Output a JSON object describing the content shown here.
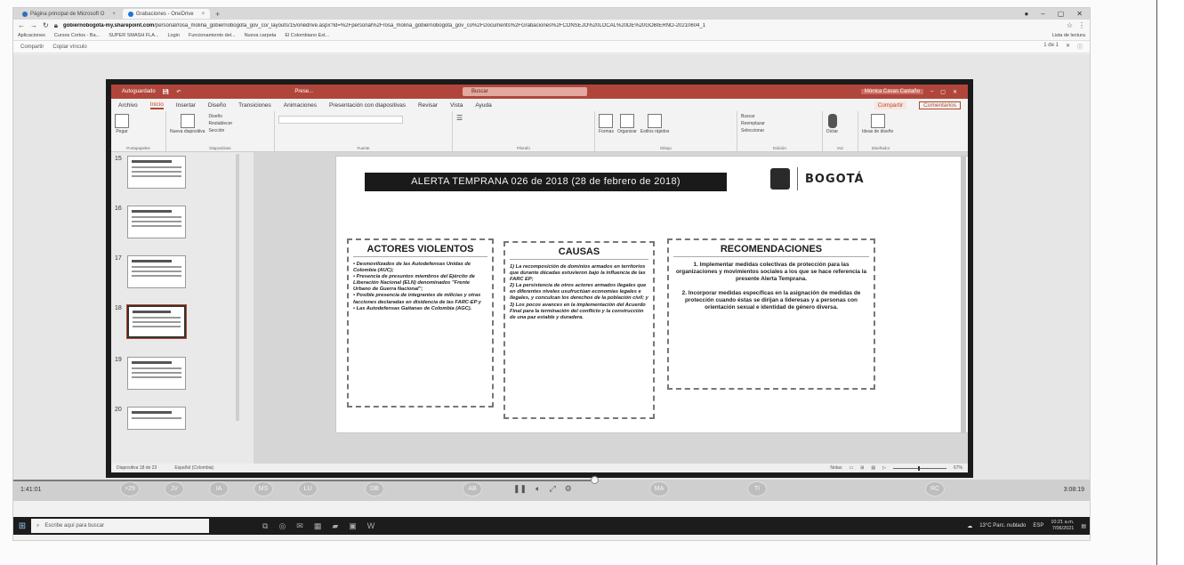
{
  "browser": {
    "tabs": [
      {
        "label": "Página principal de Microsoft O"
      },
      {
        "label": "Grabaciones - OneDrive"
      }
    ],
    "new_tab": "+",
    "url_host": "gobiernobogota-my.sharepoint.com",
    "url_path": "/personal/rosa_molina_gobiernobogota_gov_co/_layouts/15/onedrive.aspx?id=%2Fpersonal%2Frosa_molina_gobiernobogota_gov_co%2FDocuments%2FGrabaciones%2FCONSEJO%20LOCAL%20DE%20GOBIERNO-20210604_1",
    "bookmarks": [
      "Aplicaciones",
      "Cursos Cortos - Ba...",
      "SUPER SMASH FLA...",
      "Login",
      "Funcionamiento del...",
      "Nueva carpeta",
      "El Colombiano Est..."
    ],
    "reading_list": "Lista de lectura"
  },
  "onedrive": {
    "share": "Compartir",
    "copy_link": "Copiar vínculo",
    "pager": "1 de 1"
  },
  "ppt": {
    "autosave": "Autoguardado",
    "filename": "Prese...",
    "search": "Buscar",
    "user": "Mónica Casas Castaño",
    "menu": [
      "Archivo",
      "Inicio",
      "Insertar",
      "Diseño",
      "Transiciones",
      "Animaciones",
      "Presentación con diapositivas",
      "Revisar",
      "Vista",
      "Ayuda"
    ],
    "share": "Compartir",
    "comments": "Comentarios",
    "ribbon_groups": [
      {
        "label": "Portapapeles",
        "buttons": [
          "Pegar"
        ]
      },
      {
        "label": "Diapositivas",
        "buttons": [
          "Nueva diapositiva",
          "Diseño",
          "Restablecer",
          "Sección"
        ]
      },
      {
        "label": "Fuente",
        "buttons": []
      },
      {
        "label": "Párrafo",
        "buttons": []
      },
      {
        "label": "Dibujo",
        "buttons": [
          "Formas",
          "Organizar",
          "Estilos rápidos"
        ]
      },
      {
        "label": "Edición",
        "buttons": [
          "Buscar",
          "Reemplazar",
          "Seleccionar"
        ]
      },
      {
        "label": "Voz",
        "buttons": [
          "Dictar"
        ]
      },
      {
        "label": "Diseñador",
        "buttons": [
          "Ideas de diseño"
        ]
      }
    ],
    "thumb_numbers": [
      "15",
      "16",
      "17",
      "18",
      "19",
      "20"
    ],
    "selected_thumb": "18",
    "status_left": "Diapositiva 18 de 23",
    "status_lang": "Español (Colombia)",
    "status_notes": "Notas",
    "zoom": "67%"
  },
  "slide": {
    "title": "ALERTA TEMPRANA 026 de 2018 (28 de febrero de 2018)",
    "brand": "BOGOTÁ",
    "actores": {
      "heading": "ACTORES VIOLENTOS",
      "body": "• Desmovilizados de las Autodefensas Unidas de Colombia (AUC);\n• Presencia de presuntos miembros del Ejército de Liberación Nacional (ELN) denominados \"Frente Urbano de Guerra Nacional\";\n• Posible presencia de integrantes de milicias y otras facciones declaradas en disidencia de las FARC-EP y\n• Las Autodefensas Gaitanas de Colombia (AGC)."
    },
    "causas": {
      "heading": "CAUSAS",
      "body": "1) La recomposición de dominios armados en territorios que durante décadas estuvieron bajo la influencia de las FARC EP;\n2) La persistencia de otros actores armados ilegales que en diferentes niveles usufructúan economías legales e ilegales, y conculcan los derechos de la población civil; y\n3) Los pocos avances en la implementación del Acuerdo Final para la terminación del conflicto y la construcción de una paz estable y duradera."
    },
    "recomendaciones": {
      "heading": "RECOMENDACIONES",
      "body": "1. Implementar medidas colectivas de protección para las organizaciones y movimientos sociales a los que se hace referencia la presente Alerta Temprana.\n\n2. Incorporar medidas específicas en la asignación de medidas de protección cuando éstas se dirijan a lideresas y a personas con orientación sexual e identidad de género diversa."
    }
  },
  "player": {
    "elapsed": "1:41:01",
    "total": "3:08:19",
    "progress_fraction": 0.54,
    "participants": [
      "+29",
      "JV",
      "IA",
      "MS",
      "LU",
      "DB",
      "AB",
      "MA",
      "TI",
      "RC"
    ],
    "controls": [
      "pause",
      "volume",
      "expand",
      "settings"
    ]
  },
  "taskbar": {
    "search_placeholder": "Escribe aquí para buscar",
    "weather": "13°C Parc. nublado",
    "lang": "ESP",
    "time": "10:21 a.m.",
    "date": "7/06/2021"
  }
}
